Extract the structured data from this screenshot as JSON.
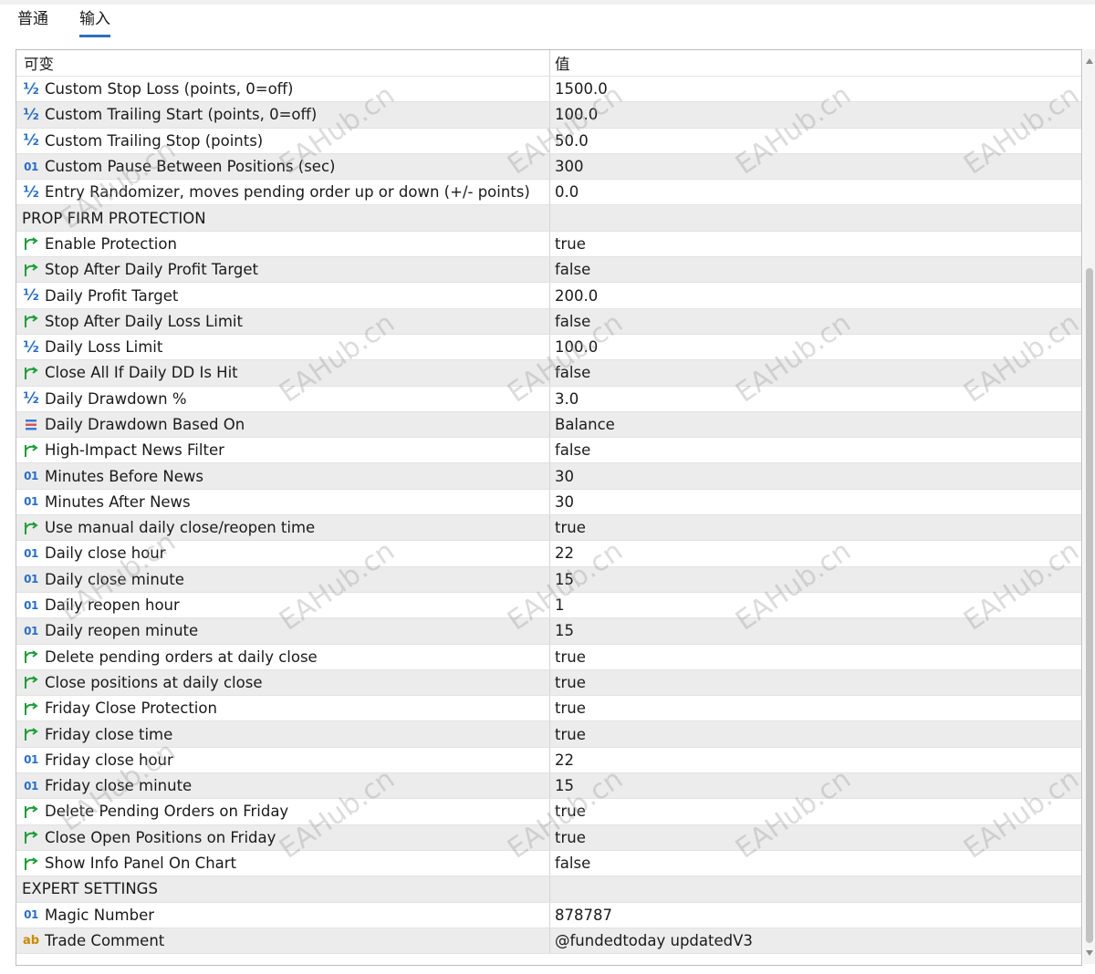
{
  "tabs": [
    {
      "label": "普通",
      "active": false
    },
    {
      "label": "输入",
      "active": true
    }
  ],
  "table": {
    "headers": {
      "name": "可变",
      "value": "值"
    },
    "rows": [
      {
        "type": "double",
        "name": "Custom Stop Loss (points, 0=off)",
        "value": "1500.0"
      },
      {
        "type": "double",
        "name": "Custom Trailing Start (points, 0=off)",
        "value": "100.0"
      },
      {
        "type": "double",
        "name": "Custom Trailing Stop (points)",
        "value": "50.0"
      },
      {
        "type": "int",
        "name": "Custom Pause Between Positions (sec)",
        "value": "300"
      },
      {
        "type": "double",
        "name": "Entry Randomizer, moves pending order up or down (+/- points)",
        "value": "0.0"
      },
      {
        "type": "section",
        "name": "PROP FIRM PROTECTION",
        "value": ""
      },
      {
        "type": "bool",
        "name": "Enable Protection",
        "value": "true"
      },
      {
        "type": "bool",
        "name": "Stop After Daily Profit Target",
        "value": "false"
      },
      {
        "type": "double",
        "name": "Daily Profit Target",
        "value": "200.0"
      },
      {
        "type": "bool",
        "name": "Stop After Daily Loss Limit",
        "value": "false"
      },
      {
        "type": "double",
        "name": "Daily Loss Limit",
        "value": "100.0"
      },
      {
        "type": "bool",
        "name": "Close All If Daily DD Is Hit",
        "value": "false"
      },
      {
        "type": "double",
        "name": "Daily Drawdown %",
        "value": "3.0"
      },
      {
        "type": "enum",
        "name": "Daily Drawdown Based On",
        "value": "Balance"
      },
      {
        "type": "bool",
        "name": "High-Impact News Filter",
        "value": "false"
      },
      {
        "type": "int",
        "name": "Minutes Before News",
        "value": "30"
      },
      {
        "type": "int",
        "name": "Minutes After News",
        "value": "30"
      },
      {
        "type": "bool",
        "name": "Use manual daily close/reopen time",
        "value": "true"
      },
      {
        "type": "int",
        "name": "Daily close hour",
        "value": "22"
      },
      {
        "type": "int",
        "name": "Daily close minute",
        "value": "15"
      },
      {
        "type": "int",
        "name": "Daily reopen hour",
        "value": "1"
      },
      {
        "type": "int",
        "name": "Daily reopen minute",
        "value": "15"
      },
      {
        "type": "bool",
        "name": "Delete pending orders at daily close",
        "value": "true"
      },
      {
        "type": "bool",
        "name": "Close positions at daily close",
        "value": "true"
      },
      {
        "type": "bool",
        "name": "Friday Close Protection",
        "value": "true"
      },
      {
        "type": "bool",
        "name": "Friday close time",
        "value": "true"
      },
      {
        "type": "int",
        "name": "Friday close hour",
        "value": "22"
      },
      {
        "type": "int",
        "name": "Friday close minute",
        "value": "15"
      },
      {
        "type": "bool",
        "name": "Delete Pending Orders on Friday",
        "value": "true"
      },
      {
        "type": "bool",
        "name": "Close Open Positions on Friday",
        "value": "true"
      },
      {
        "type": "bool",
        "name": "Show Info Panel On Chart",
        "value": "false"
      },
      {
        "type": "section",
        "name": "EXPERT SETTINGS",
        "value": ""
      },
      {
        "type": "int",
        "name": "Magic Number",
        "value": "878787"
      },
      {
        "type": "string",
        "name": "Trade Comment",
        "value": "@fundedtoday updatedV3"
      }
    ]
  },
  "icons": {
    "double": {
      "name": "fraction-icon",
      "glyph": "½"
    },
    "int": {
      "name": "integer-icon",
      "glyph": "01"
    },
    "bool": {
      "name": "bool-arrow-icon"
    },
    "enum": {
      "name": "enum-list-icon"
    },
    "string": {
      "name": "string-icon",
      "glyph": "ab"
    }
  },
  "watermark": "EAHub.cn",
  "colors": {
    "accent": "#2f6fbf",
    "row_alt": "#ececec",
    "bool_icon": "#1e9e3a",
    "int_icon": "#2a6fc0",
    "string_icon": "#c98a00"
  }
}
